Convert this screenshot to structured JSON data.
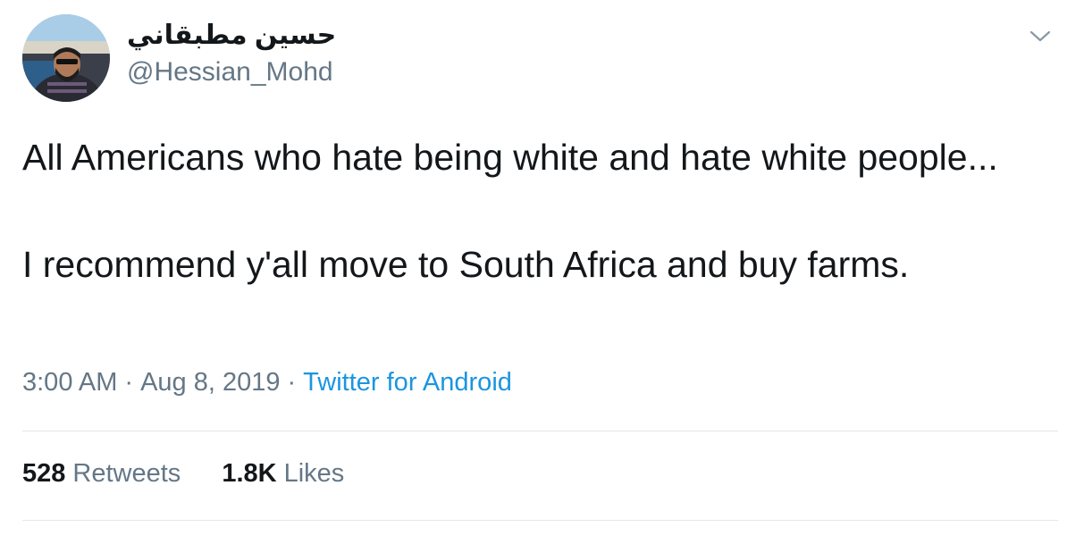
{
  "author": {
    "display_name": "حسين مطبقاني",
    "handle": "@Hessian_Mohd",
    "avatar_icon": "user-photo"
  },
  "tweet": {
    "line1": "All Americans who hate being white and hate white people...",
    "line2": "I recommend y'all move to South Africa and buy farms."
  },
  "meta": {
    "time": "3:00 AM",
    "separator": "·",
    "date": "Aug 8, 2019",
    "source": "Twitter for Android"
  },
  "stats": {
    "retweets_count": "528",
    "retweets_label": "Retweets",
    "likes_count": "1.8K",
    "likes_label": "Likes"
  },
  "colors": {
    "text": "#14171a",
    "secondary": "#657786",
    "link": "#1b95e0",
    "divider": "#e1e8ed"
  }
}
